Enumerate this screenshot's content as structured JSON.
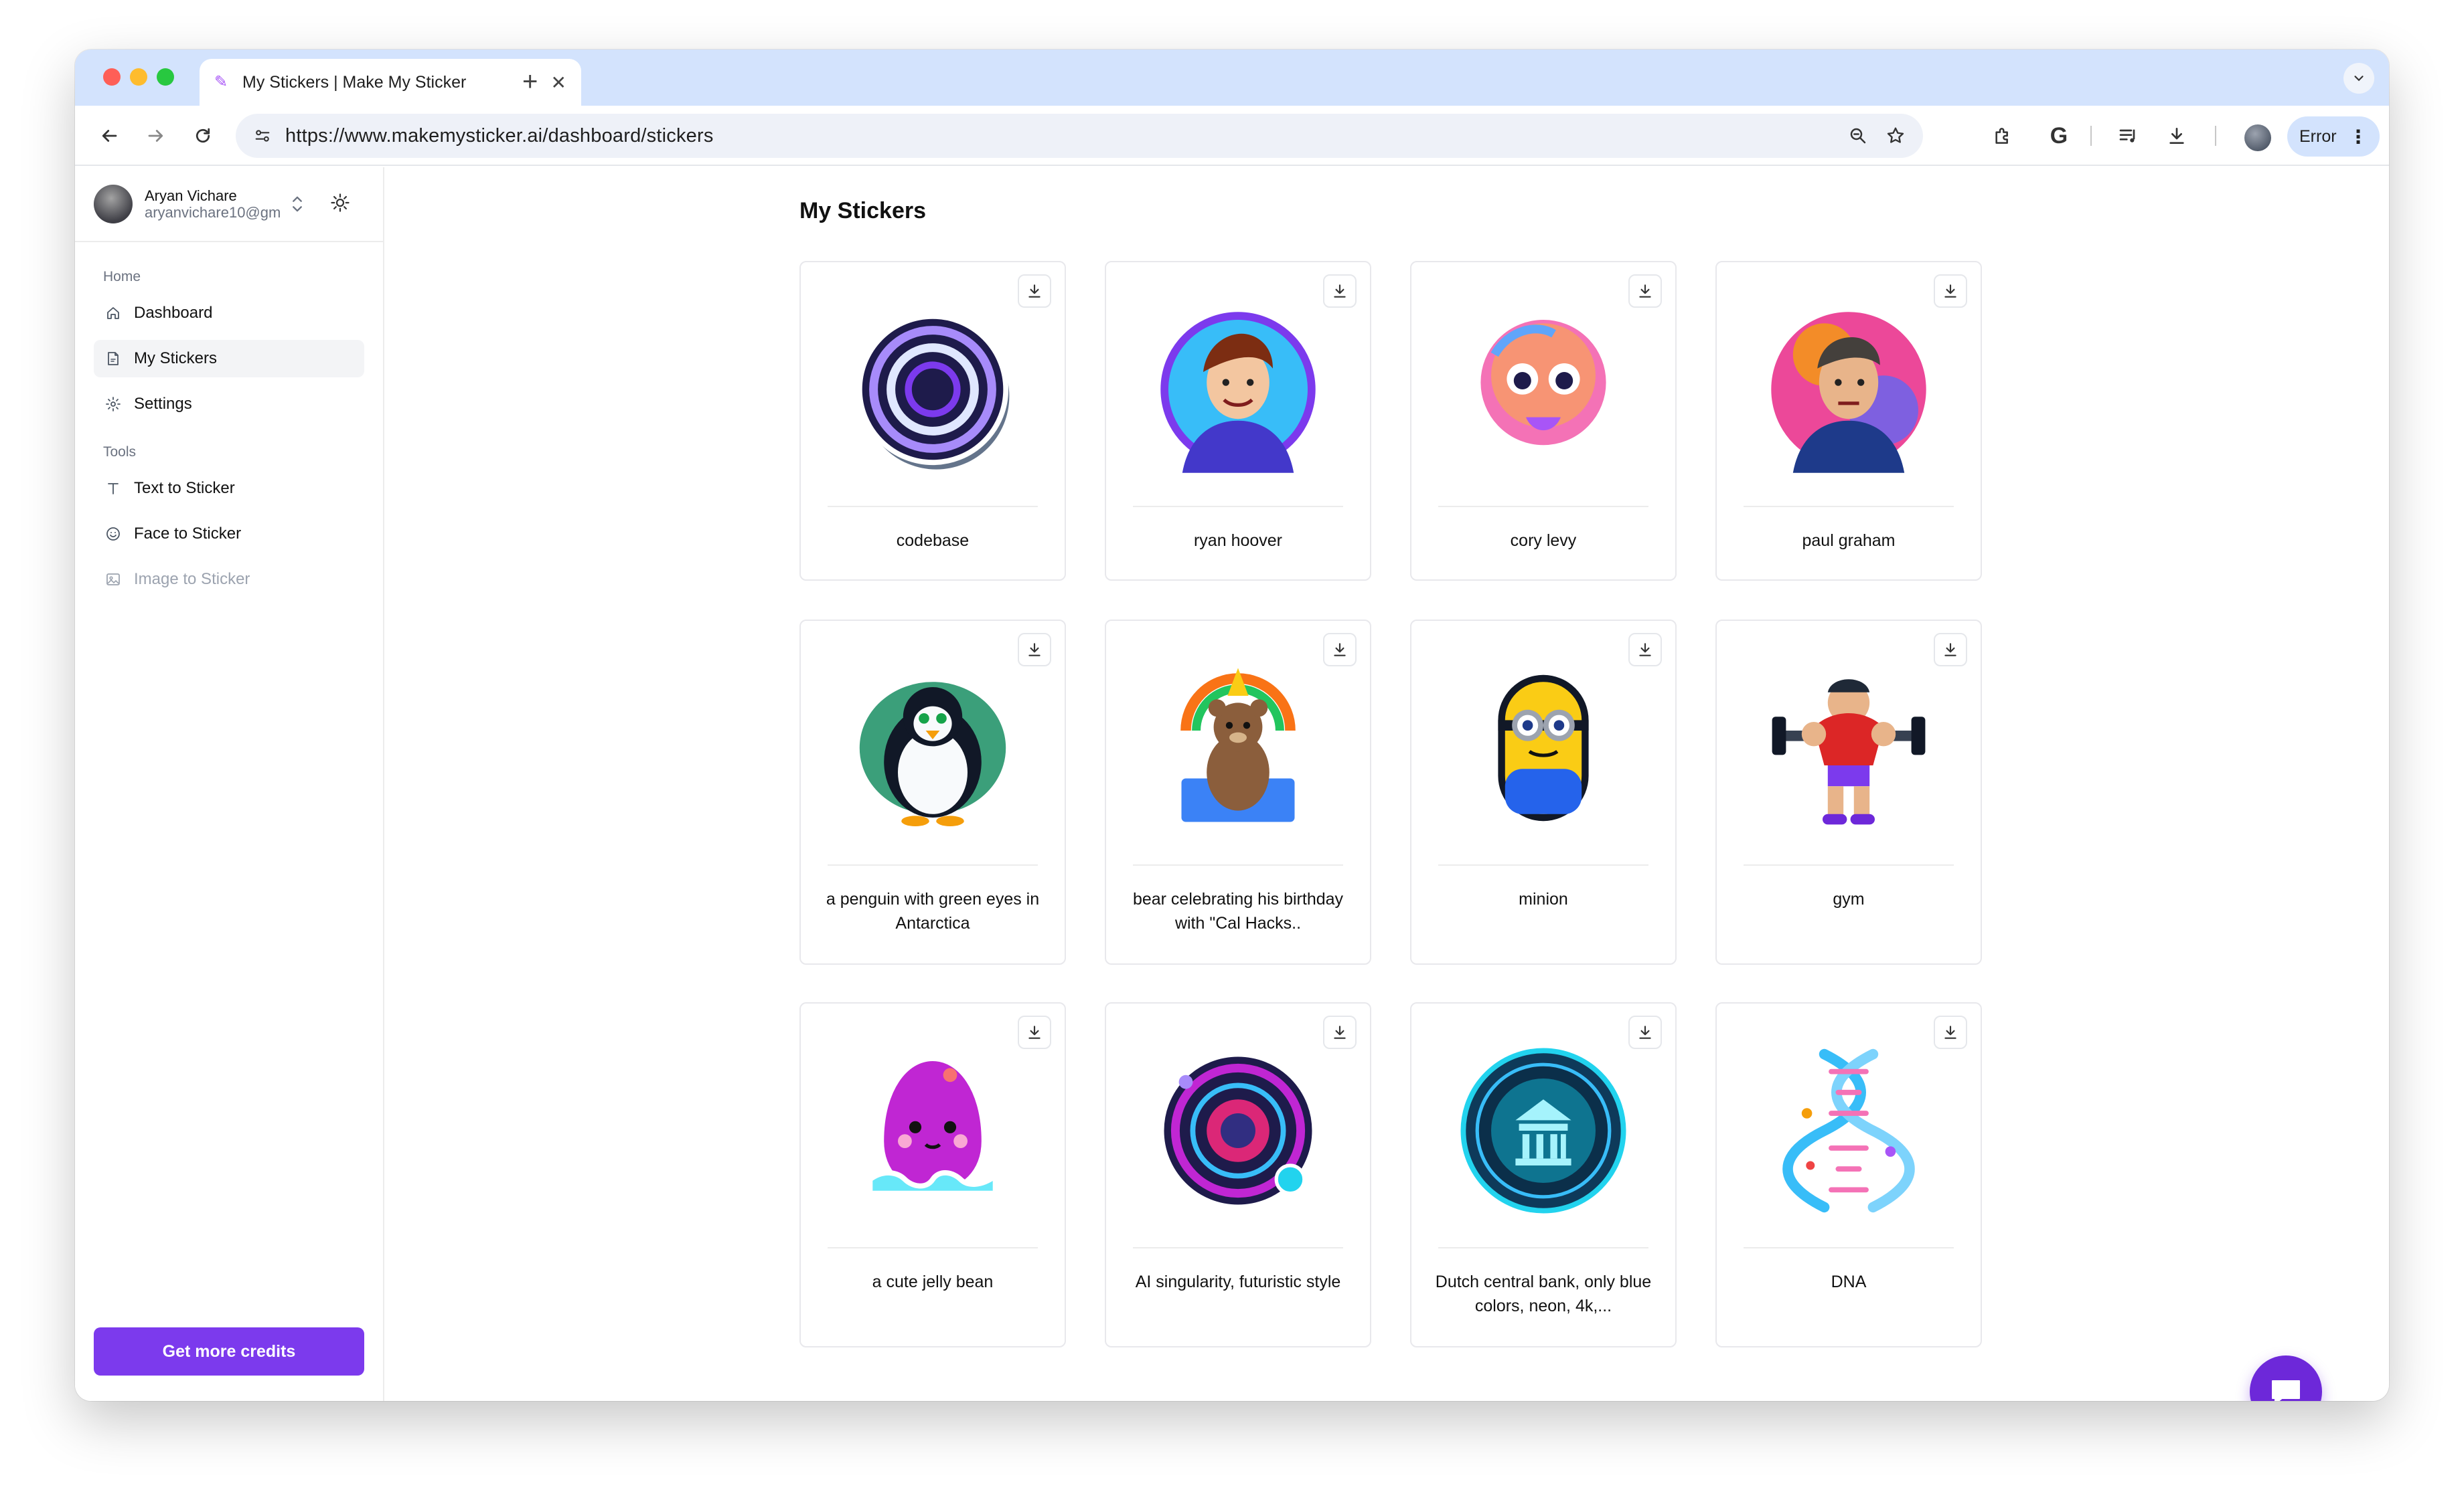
{
  "browser": {
    "tab_title": "My Stickers | Make My Sticker",
    "url": "https://www.makemysticker.ai/dashboard/stickers",
    "profile_status": "Error"
  },
  "sidebar": {
    "user_name": "Aryan Vichare",
    "user_email": "aryanvichare10@gm",
    "home_label": "Home",
    "home_items": [
      {
        "label": "Dashboard",
        "icon": "home-icon"
      },
      {
        "label": "My Stickers",
        "icon": "sticker-icon",
        "active": true
      },
      {
        "label": "Settings",
        "icon": "gear-icon"
      }
    ],
    "tools_label": "Tools",
    "tool_items": [
      {
        "label": "Text to Sticker",
        "icon": "text-icon"
      },
      {
        "label": "Face to Sticker",
        "icon": "smile-icon"
      },
      {
        "label": "Image to Sticker",
        "icon": "image-icon",
        "disabled": true
      }
    ],
    "credits_button": "Get more credits"
  },
  "main": {
    "title": "My Stickers",
    "stickers": [
      {
        "label": "codebase",
        "art": "ring"
      },
      {
        "label": "ryan hoover",
        "art": "portrait-man"
      },
      {
        "label": "cory levy",
        "art": "creature"
      },
      {
        "label": "paul graham",
        "art": "portrait-older"
      },
      {
        "label": "a penguin with green eyes in Antarctica",
        "art": "penguin"
      },
      {
        "label": "bear celebrating his birthday with \"Cal Hacks..",
        "art": "bear"
      },
      {
        "label": "minion",
        "art": "minion"
      },
      {
        "label": "gym",
        "art": "gym"
      },
      {
        "label": "a cute jelly bean",
        "art": "jellybean"
      },
      {
        "label": "AI singularity, futuristic style",
        "art": "singularity"
      },
      {
        "label": "Dutch central bank, only blue colors, neon, 4k,...",
        "art": "bank-seal"
      },
      {
        "label": "DNA",
        "art": "dna"
      }
    ]
  }
}
